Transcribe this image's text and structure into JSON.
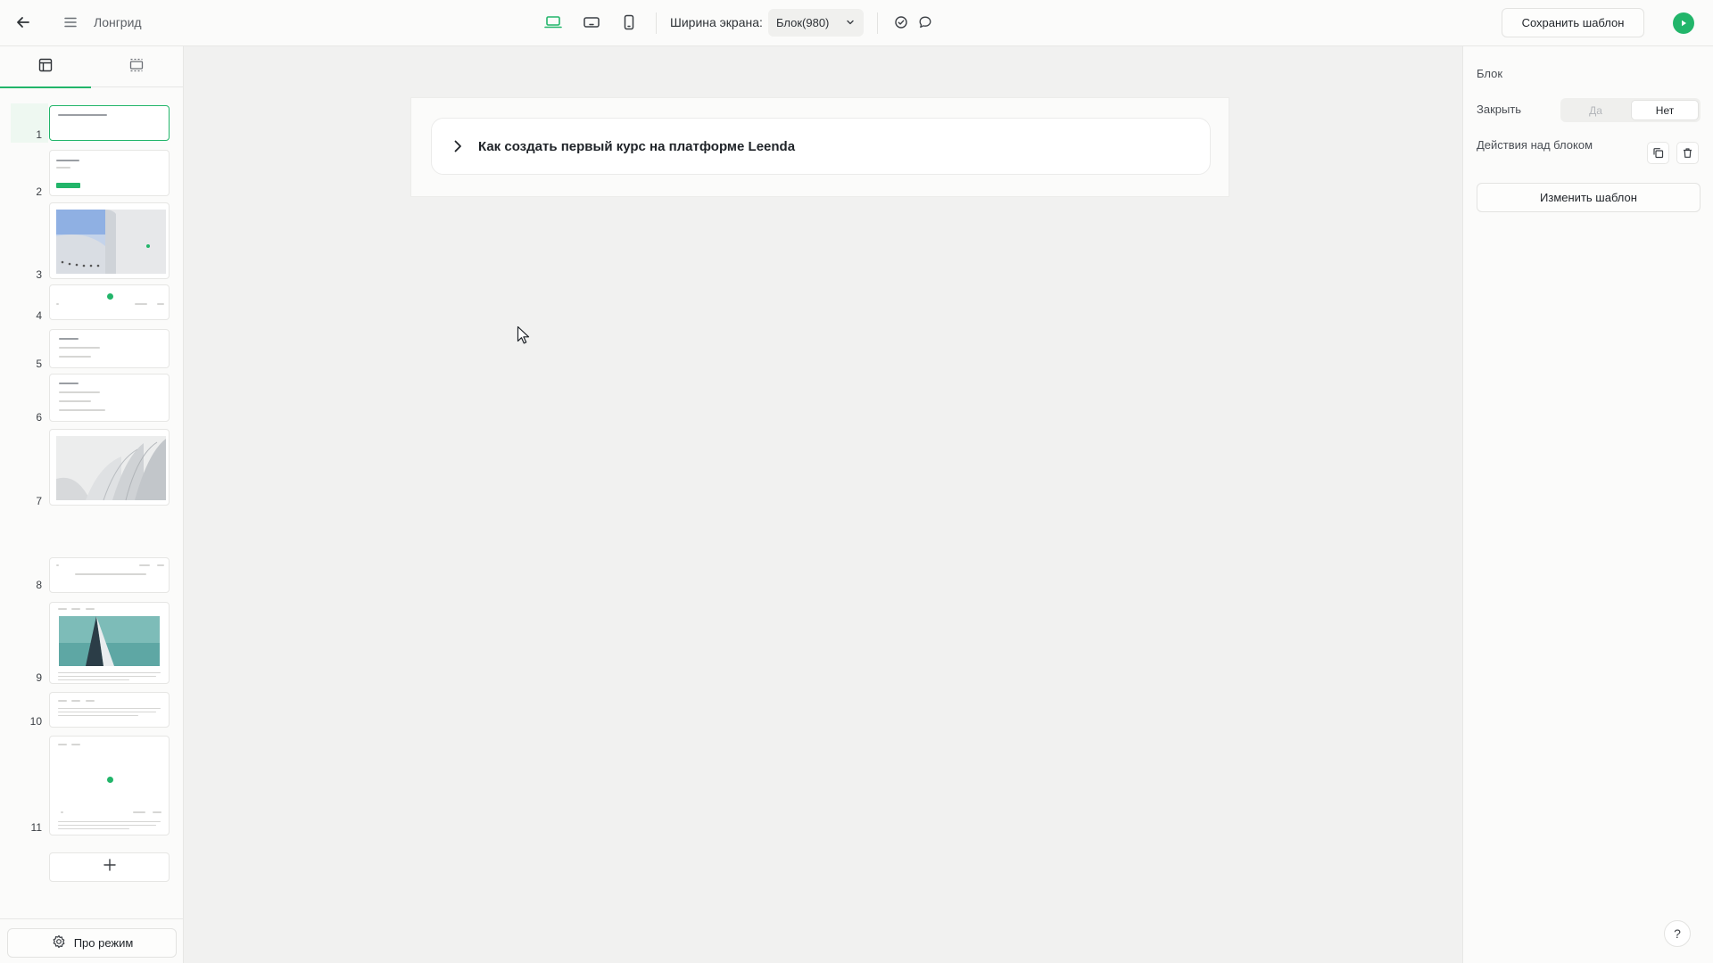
{
  "app": {
    "title": "Лонгрид"
  },
  "toolbar": {
    "screen_width_label": "Ширина экрана:",
    "screen_width_value": "Блок(980)",
    "save_template_label": "Сохранить шаблон",
    "icons": [
      "back-arrow-icon",
      "menu-icon",
      "desktop-icon",
      "tablet-icon",
      "mobile-icon",
      "check-circle-icon",
      "comment-icon",
      "play-icon"
    ]
  },
  "sidebar": {
    "tabs": [
      "layout-icon",
      "blocks-icon"
    ],
    "active_tab": 0,
    "slides": [
      "1",
      "2",
      "3",
      "4",
      "5",
      "6",
      "7",
      "8",
      "9",
      "10",
      "11"
    ],
    "active_slide": 1,
    "add_slide_icon": "plus-icon",
    "pro_mode_label": "Про режим"
  },
  "canvas": {
    "accordion_title": "Как создать первый курс на платформе Leenda"
  },
  "right_panel": {
    "section_title": "Блок",
    "close_label": "Закрыть",
    "close_options": [
      "Да",
      "Нет"
    ],
    "close_selected": "Нет",
    "actions_label": "Действия над блоком",
    "change_template_label": "Изменить шаблон",
    "help_label": "?"
  },
  "colors": {
    "accent": "#22b56a",
    "background": "#f1f1f0",
    "panel": "#fbfbfa"
  }
}
